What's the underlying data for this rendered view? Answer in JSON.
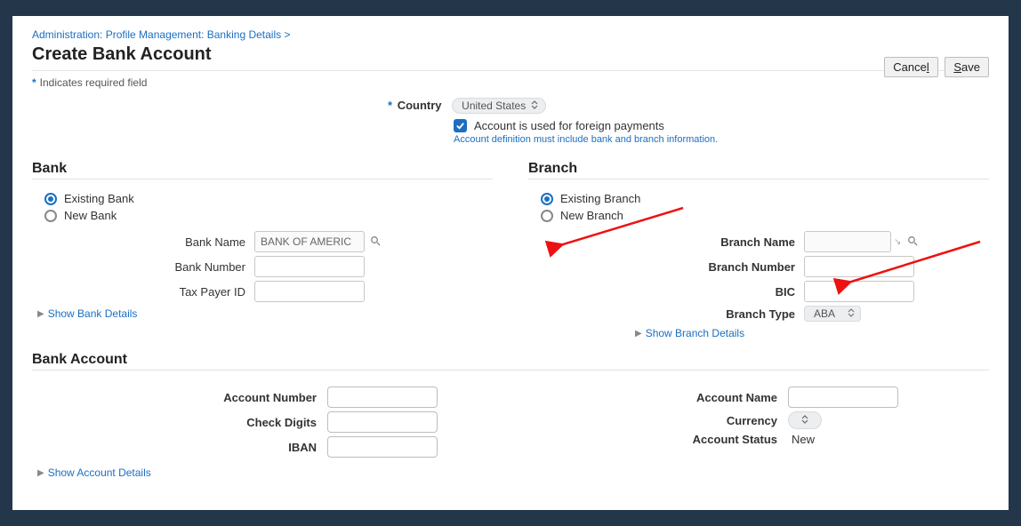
{
  "breadcrumb": "Administration: Profile Management: Banking Details  >",
  "page_title": "Create Bank Account",
  "required_note": "Indicates required field",
  "buttons": {
    "cancel": "Cancel",
    "save": "Save"
  },
  "country": {
    "label": "Country",
    "value": "United States"
  },
  "foreign_checkbox_label": "Account is used for foreign payments",
  "foreign_hint": "Account definition must include bank and branch information.",
  "bank": {
    "heading": "Bank",
    "existing_label": "Existing Bank",
    "new_label": "New Bank",
    "bank_name_label": "Bank Name",
    "bank_name_value": "BANK OF AMERIC",
    "bank_number_label": "Bank Number",
    "tax_payer_label": "Tax Payer ID",
    "show_details": "Show Bank Details"
  },
  "branch": {
    "heading": "Branch",
    "existing_label": "Existing Branch",
    "new_label": "New Branch",
    "branch_name_label": "Branch Name",
    "branch_number_label": "Branch Number",
    "bic_label": "BIC",
    "branch_type_label": "Branch Type",
    "branch_type_value": "ABA",
    "show_details": "Show Branch Details"
  },
  "account": {
    "heading": "Bank Account",
    "account_number_label": "Account Number",
    "check_digits_label": "Check Digits",
    "iban_label": "IBAN",
    "account_name_label": "Account Name",
    "currency_label": "Currency",
    "status_label": "Account Status",
    "status_value": "New",
    "show_details": "Show Account Details"
  }
}
